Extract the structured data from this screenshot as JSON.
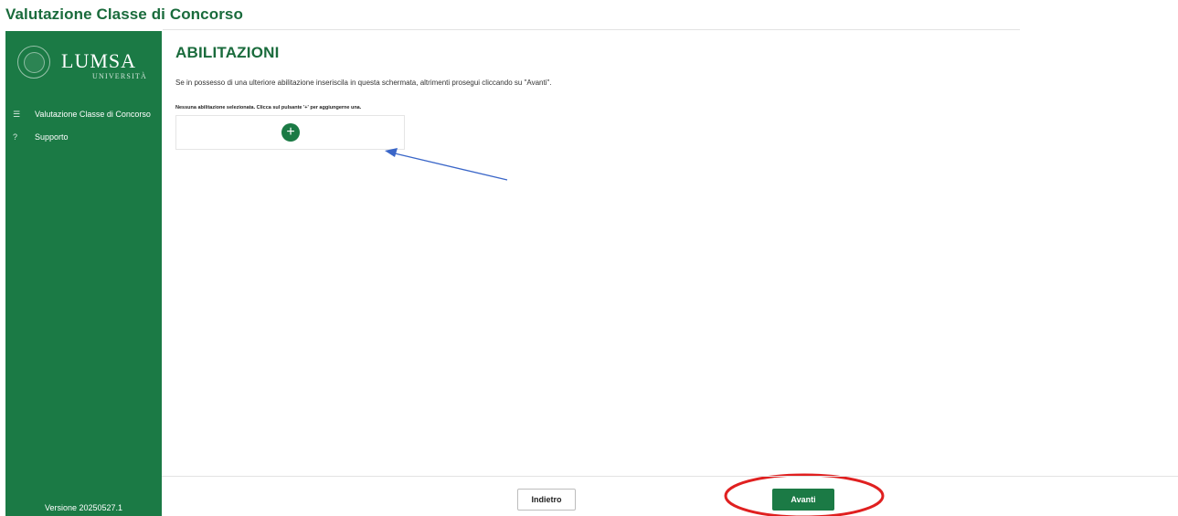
{
  "app": {
    "title": "Valutazione Classe di Concorso"
  },
  "sidebar": {
    "logo": {
      "name": "LUMSA",
      "subtitle": "UNIVERSITÀ"
    },
    "items": [
      {
        "label": "Valutazione Classe di Concorso",
        "icon": "list-icon",
        "icon_glyph": "☰"
      },
      {
        "label": "Supporto",
        "icon": "help-icon",
        "icon_glyph": "?"
      }
    ],
    "version": "Versione 20250527.1",
    "background_color": "#1b7a45"
  },
  "main": {
    "title": "ABILITAZIONI",
    "intro": "Se in possesso di una ulteriore abilitazione inseriscila in questa schermata, altrimenti prosegui cliccando su \"Avanti\".",
    "empty_message": "Nessuna abilitazione selezionata. Clicca sul pulsante '+' per aggiungerne una.",
    "add_button_glyph": "+"
  },
  "footer": {
    "back_label": "Indietro",
    "next_label": "Avanti"
  },
  "annotations": {
    "arrow_color": "#3a66c8",
    "highlight_color": "#e02020"
  },
  "colors": {
    "accent": "#1b7a45",
    "title": "#1a6b3c"
  }
}
